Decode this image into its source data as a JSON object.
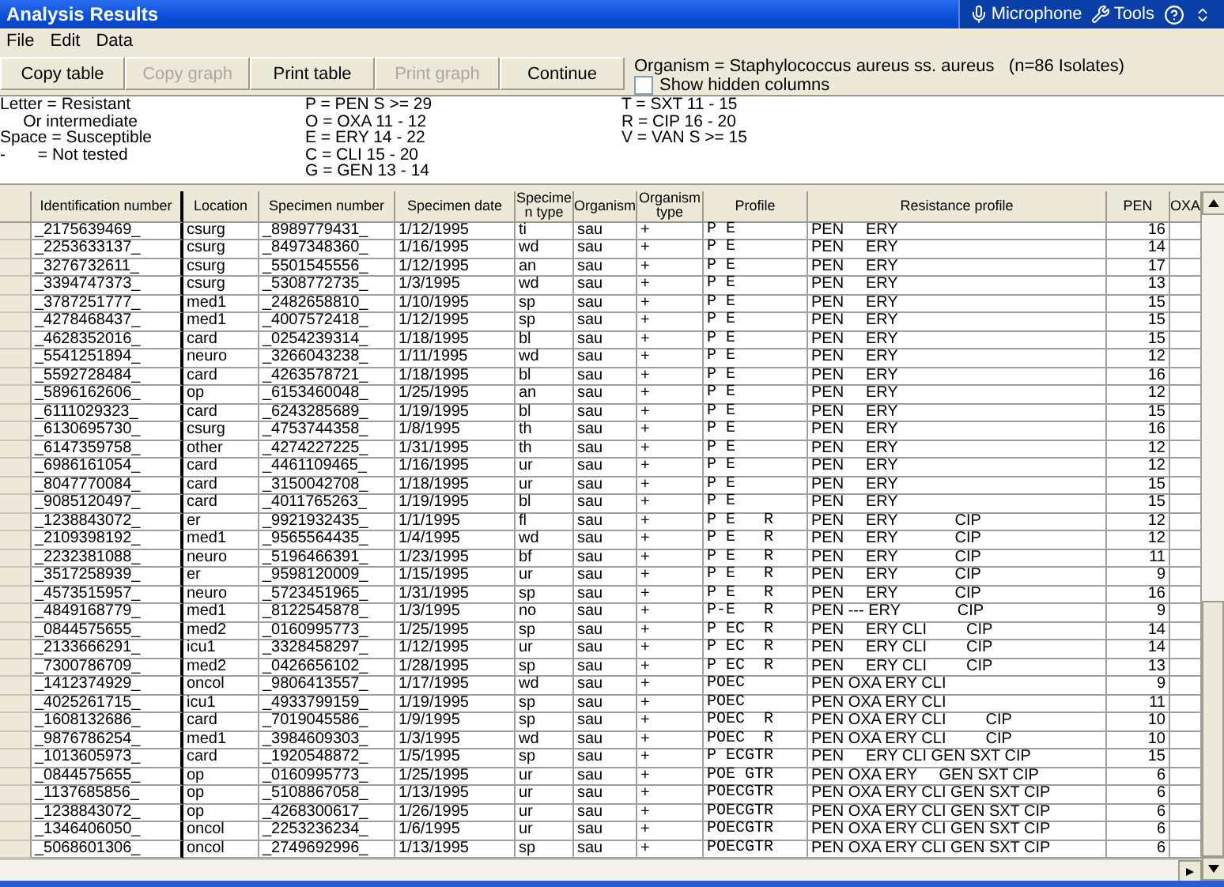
{
  "window": {
    "title": "Analysis Results"
  },
  "title_bar_tools": [
    {
      "kind": "microphone",
      "label": "Microphone"
    },
    {
      "kind": "tools",
      "label": "Tools"
    },
    {
      "kind": "help"
    }
  ],
  "menu": [
    "File",
    "Edit",
    "Data"
  ],
  "toolbar": {
    "buttons": [
      {
        "label": "Copy table",
        "disabled": false
      },
      {
        "label": "Copy graph",
        "disabled": true
      },
      {
        "label": "Print table",
        "disabled": false
      },
      {
        "label": "Print graph",
        "disabled": true
      },
      {
        "label": "Continue",
        "disabled": false
      }
    ],
    "organism": "Organism = Staphylococcus aureus ss. aureus   (n=86 Isolates)",
    "show_hidden_columns": {
      "label": "Show hidden columns",
      "checked": false
    }
  },
  "legend": [
    [
      "Letter = Resistant",
      "     Or intermediate",
      "Space = Susceptible",
      "-       = Not tested"
    ],
    [
      "P = PEN S >= 29",
      "O = OXA 11 - 12",
      "E = ERY 14 - 22",
      "C = CLI 15 - 20",
      "G = GEN 13 - 14"
    ],
    [
      "T = SXT 11 - 15",
      "R = CIP 16 - 20",
      "V = VAN S >= 15"
    ]
  ],
  "table": {
    "columns": [
      "Identification number",
      "Location",
      "Specimen number",
      "Specimen date",
      "Specimen type",
      "Organism",
      "Organism type",
      "Profile",
      "Resistance profile",
      "PEN",
      "OXA"
    ],
    "rows": [
      [
        "_2175639469_",
        "csurg",
        "_8989779431_",
        "1/12/1995",
        "ti",
        "sau",
        "+",
        "P E",
        "PEN     ERY",
        "16"
      ],
      [
        "_2253633137_",
        "csurg",
        "_8497348360_",
        "1/16/1995",
        "wd",
        "sau",
        "+",
        "P E",
        "PEN     ERY",
        "14"
      ],
      [
        "_3276732611_",
        "csurg",
        "_5501545556_",
        "1/12/1995",
        "an",
        "sau",
        "+",
        "P E",
        "PEN     ERY",
        "17"
      ],
      [
        "_3394747373_",
        "csurg",
        "_5308772735_",
        "1/3/1995",
        "wd",
        "sau",
        "+",
        "P E",
        "PEN     ERY",
        "13"
      ],
      [
        "_3787251777_",
        "med1",
        "_2482658810_",
        "1/10/1995",
        "sp",
        "sau",
        "+",
        "P E",
        "PEN     ERY",
        "15"
      ],
      [
        "_4278468437_",
        "med1",
        "_4007572418_",
        "1/12/1995",
        "sp",
        "sau",
        "+",
        "P E",
        "PEN     ERY",
        "15"
      ],
      [
        "_4628352016_",
        "card",
        "_0254239314_",
        "1/18/1995",
        "bl",
        "sau",
        "+",
        "P E",
        "PEN     ERY",
        "15"
      ],
      [
        "_5541251894_",
        "neuro",
        "_3266043238_",
        "1/11/1995",
        "wd",
        "sau",
        "+",
        "P E",
        "PEN     ERY",
        "12"
      ],
      [
        "_5592728484_",
        "card",
        "_4263578721_",
        "1/18/1995",
        "bl",
        "sau",
        "+",
        "P E",
        "PEN     ERY",
        "16"
      ],
      [
        "_5896162606_",
        "op",
        "_6153460048_",
        "1/25/1995",
        "an",
        "sau",
        "+",
        "P E",
        "PEN     ERY",
        "12"
      ],
      [
        "_6111029323_",
        "card",
        "_6243285689_",
        "1/19/1995",
        "bl",
        "sau",
        "+",
        "P E",
        "PEN     ERY",
        "15"
      ],
      [
        "_6130695730_",
        "csurg",
        "_4753744358_",
        "1/8/1995",
        "th",
        "sau",
        "+",
        "P E",
        "PEN     ERY",
        "16"
      ],
      [
        "_6147359758_",
        "other",
        "_4274227225_",
        "1/31/1995",
        "th",
        "sau",
        "+",
        "P E",
        "PEN     ERY",
        "12"
      ],
      [
        "_6986161054_",
        "card",
        "_4461109465_",
        "1/16/1995",
        "ur",
        "sau",
        "+",
        "P E",
        "PEN     ERY",
        "12"
      ],
      [
        "_8047770084_",
        "card",
        "_3150042708_",
        "1/18/1995",
        "ur",
        "sau",
        "+",
        "P E",
        "PEN     ERY",
        "15"
      ],
      [
        "_9085120497_",
        "card",
        "_4011765263_",
        "1/19/1995",
        "bl",
        "sau",
        "+",
        "P E",
        "PEN     ERY",
        "15"
      ],
      [
        "_1238843072_",
        "er",
        "_9921932435_",
        "1/1/1995",
        "fl",
        "sau",
        "+",
        "P E   R",
        "PEN     ERY             CIP",
        "12"
      ],
      [
        "_2109398192_",
        "med1",
        "_9565564435_",
        "1/4/1995",
        "wd",
        "sau",
        "+",
        "P E   R",
        "PEN     ERY             CIP",
        "12"
      ],
      [
        "_2232381088_",
        "neuro",
        "_5196466391_",
        "1/23/1995",
        "bf",
        "sau",
        "+",
        "P E   R",
        "PEN     ERY             CIP",
        "11"
      ],
      [
        "_3517258939_",
        "er",
        "_9598120009_",
        "1/15/1995",
        "ur",
        "sau",
        "+",
        "P E   R",
        "PEN     ERY             CIP",
        "9"
      ],
      [
        "_4573515957_",
        "neuro",
        "_5723451965_",
        "1/31/1995",
        "sp",
        "sau",
        "+",
        "P E   R",
        "PEN     ERY             CIP",
        "16"
      ],
      [
        "_4849168779_",
        "med1",
        "_8122545878_",
        "1/3/1995",
        "no",
        "sau",
        "+",
        "P-E   R",
        "PEN --- ERY             CIP",
        "9"
      ],
      [
        "_0844575655_",
        "med2",
        "_0160995773_",
        "1/25/1995",
        "sp",
        "sau",
        "+",
        "P EC  R",
        "PEN     ERY CLI         CIP",
        "14"
      ],
      [
        "_2133666291_",
        "icu1",
        "_3328458297_",
        "1/12/1995",
        "ur",
        "sau",
        "+",
        "P EC  R",
        "PEN     ERY CLI         CIP",
        "14"
      ],
      [
        "_7300786709_",
        "med2",
        "_0426656102_",
        "1/28/1995",
        "sp",
        "sau",
        "+",
        "P EC  R",
        "PEN     ERY CLI         CIP",
        "13"
      ],
      [
        "_1412374929_",
        "oncol",
        "_9806413557_",
        "1/17/1995",
        "wd",
        "sau",
        "+",
        "POEC",
        "PEN OXA ERY CLI",
        "9"
      ],
      [
        "_4025261715_",
        "icu1",
        "_4933799159_",
        "1/19/1995",
        "sp",
        "sau",
        "+",
        "POEC",
        "PEN OXA ERY CLI",
        "11"
      ],
      [
        "_1608132686_",
        "card",
        "_7019045586_",
        "1/9/1995",
        "sp",
        "sau",
        "+",
        "POEC  R",
        "PEN OXA ERY CLI         CIP",
        "10"
      ],
      [
        "_9876786254_",
        "med1",
        "_3984609303_",
        "1/3/1995",
        "wd",
        "sau",
        "+",
        "POEC  R",
        "PEN OXA ERY CLI         CIP",
        "10"
      ],
      [
        "_1013605973_",
        "card",
        "_1920548872_",
        "1/5/1995",
        "sp",
        "sau",
        "+",
        "P ECGTR",
        "PEN     ERY CLI GEN SXT CIP",
        "15"
      ],
      [
        "_0844575655_",
        "op",
        "_0160995773_",
        "1/25/1995",
        "ur",
        "sau",
        "+",
        "POE GTR",
        "PEN OXA ERY     GEN SXT CIP",
        "6"
      ],
      [
        "_1137685856_",
        "op",
        "_5108867058_",
        "1/13/1995",
        "ur",
        "sau",
        "+",
        "POECGTR",
        "PEN OXA ERY CLI GEN SXT CIP",
        "6"
      ],
      [
        "_1238843072_",
        "op",
        "_4268300617_",
        "1/26/1995",
        "ur",
        "sau",
        "+",
        "POECGTR",
        "PEN OXA ERY CLI GEN SXT CIP",
        "6"
      ],
      [
        "_1346406050_",
        "oncol",
        "_2253236234_",
        "1/6/1995",
        "ur",
        "sau",
        "+",
        "POECGTR",
        "PEN OXA ERY CLI GEN SXT CIP",
        "6"
      ],
      [
        "_5068601306_",
        "oncol",
        "_2749692996_",
        "1/13/1995",
        "sp",
        "sau",
        "+",
        "POECGTR",
        "PEN OXA ERY CLI GEN SXT CIP",
        "6"
      ]
    ]
  }
}
